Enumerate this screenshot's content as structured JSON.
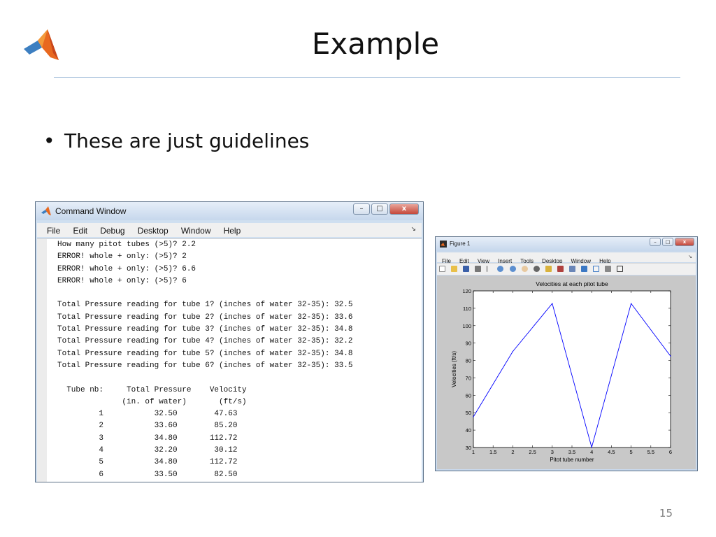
{
  "slide": {
    "title": "Example",
    "bullets": [
      "These are just guidelines"
    ],
    "page_number": "15"
  },
  "command_window": {
    "title": "Command Window",
    "menu": [
      "File",
      "Edit",
      "Debug",
      "Desktop",
      "Window",
      "Help"
    ],
    "undock_glyph": "↘",
    "lines": [
      "How many pitot tubes (>5)? 2.2",
      "ERROR! whole + only: (>5)? 2",
      "ERROR! whole + only: (>5)? 6.6",
      "ERROR! whole + only: (>5)? 6",
      "",
      "Total Pressure reading for tube 1? (inches of water 32-35): 32.5",
      "Total Pressure reading for tube 2? (inches of water 32-35): 33.6",
      "Total Pressure reading for tube 3? (inches of water 32-35): 34.8",
      "Total Pressure reading for tube 4? (inches of water 32-35): 32.2",
      "Total Pressure reading for tube 5? (inches of water 32-35): 34.8",
      "Total Pressure reading for tube 6? (inches of water 32-35): 33.5",
      "",
      "  Tube nb:     Total Pressure    Velocity",
      "              (in. of water)       (ft/s)",
      "         1           32.50        47.63",
      "         2           33.60        85.20",
      "         3           34.80       112.72",
      "         4           32.20        30.12",
      "         5           34.80       112.72",
      "         6           33.50        82.50"
    ]
  },
  "figure_window": {
    "title": "Figure 1",
    "menu": [
      "File",
      "Edit",
      "View",
      "Insert",
      "Tools",
      "Desktop",
      "Window",
      "Help"
    ],
    "undock_glyph": "↘"
  },
  "chart_data": {
    "type": "line",
    "title": "Velocities at each pitot tube",
    "xlabel": "Pitot tube number",
    "ylabel": "Velocities (ft/s)",
    "xlim": [
      1,
      6
    ],
    "ylim": [
      30,
      120
    ],
    "xticks": [
      "1",
      "1.5",
      "2",
      "2.5",
      "3",
      "3.5",
      "4",
      "4.5",
      "5",
      "5.5",
      "6"
    ],
    "yticks": [
      "30",
      "40",
      "50",
      "60",
      "70",
      "80",
      "90",
      "100",
      "110",
      "120"
    ],
    "x": [
      1,
      2,
      3,
      4,
      5,
      6
    ],
    "values": [
      47.63,
      85.2,
      112.72,
      30.12,
      112.72,
      82.5
    ],
    "line_color": "#0000ff",
    "grid": false
  }
}
